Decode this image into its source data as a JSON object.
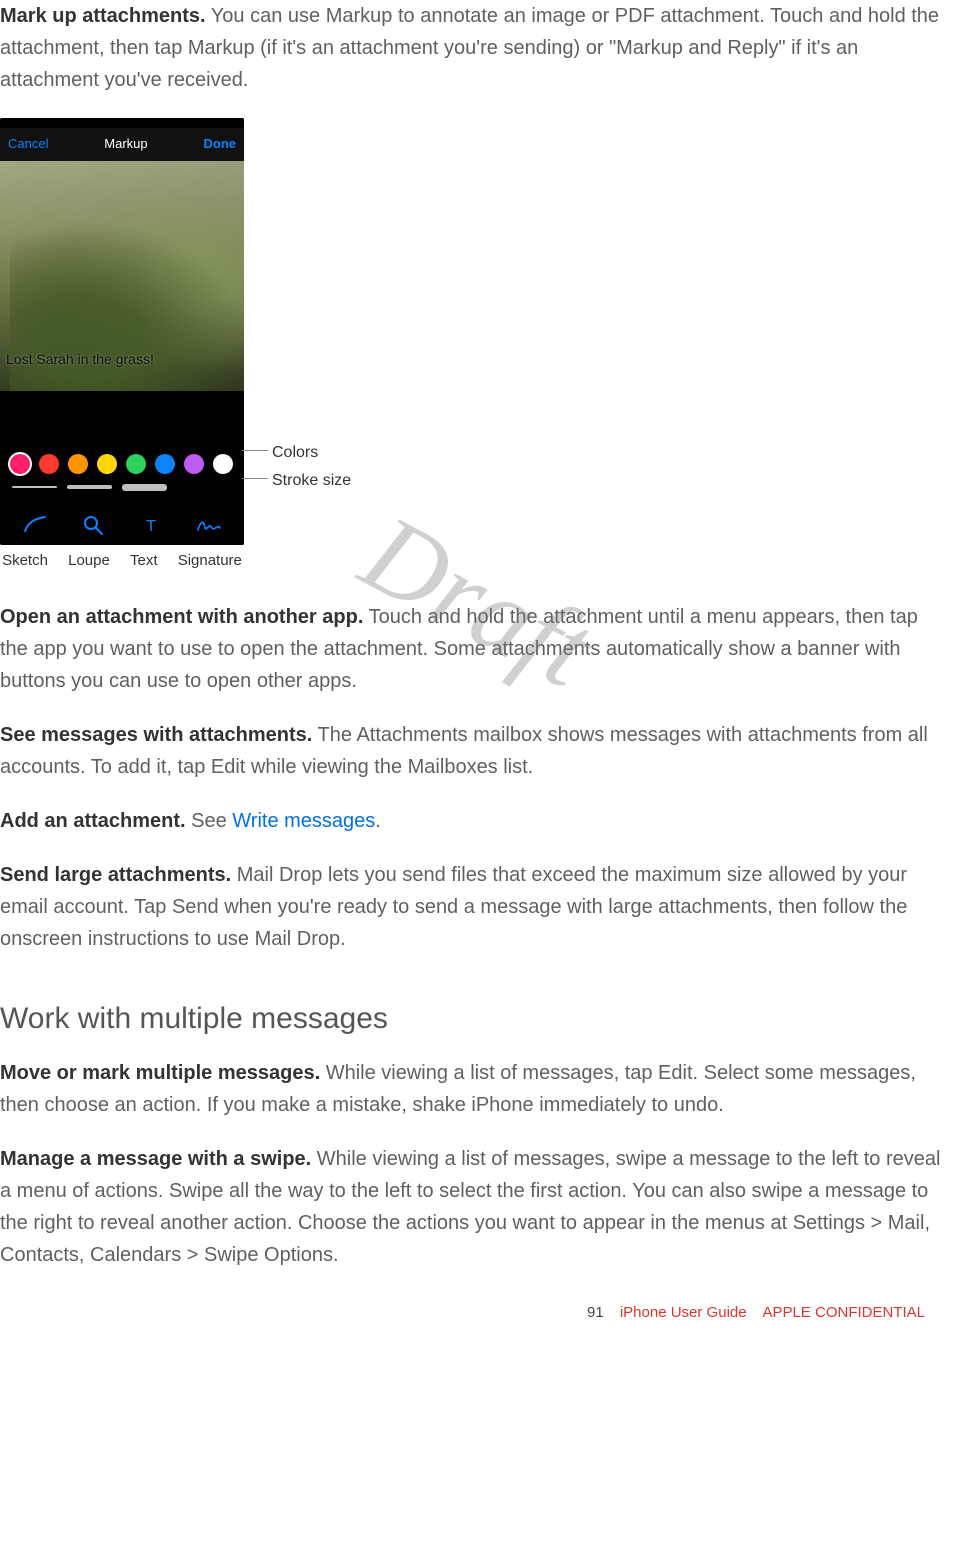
{
  "paragraphs": {
    "markup_title": "Mark up attachments.",
    "markup_body": " You can use Markup to annotate an image or PDF attachment. Touch and hold the attachment, then tap Markup (if it's an attachment you're sending) or \"Markup and Reply\" if it's an attachment you've received.",
    "open_title": "Open an attachment with another app.",
    "open_body": " Touch and hold the attachment until a menu appears, then tap the app you want to use to open the attachment. Some attachments automatically show a banner with buttons you can use to open other apps.",
    "see_title": "See messages with attachments.",
    "see_body": " The Attachments mailbox shows messages with attachments from all accounts. To add it, tap Edit while viewing the Mailboxes list.",
    "add_title": "Add an attachment.",
    "add_pre": " See ",
    "add_link": "Write messages",
    "add_post": ".",
    "send_title": "Send large attachments.",
    "send_body": " Mail Drop lets you send files that exceed the maximum size allowed by your email account. Tap Send when you're ready to send a message with large attachments, then follow the onscreen instructions to use Mail Drop.",
    "move_title": "Move or mark multiple messages. ",
    "move_body": " While viewing a list of messages, tap Edit. Select some messages, then choose an action. If you make a mistake, shake iPhone immediately to undo.",
    "manage_title": "Manage a message with a swipe.",
    "manage_body": " While viewing a list of messages, swipe a message to the left to reveal a menu of actions. Swipe all the way to the left to select the first action. You can also swipe a message to the right to reveal another action. Choose the actions you want to appear in the menus at Settings > Mail, Contacts, Calendars > Swipe Options."
  },
  "heading_work": "Work with multiple messages",
  "watermark": "Draft",
  "figure": {
    "nav": {
      "cancel": "Cancel",
      "title": "Markup",
      "done": "Done"
    },
    "photo_caption": "Lost Sarah in the grass!",
    "callouts": {
      "colors": "Colors",
      "stroke": "Stroke size"
    },
    "tool_labels": [
      "Sketch",
      "Loupe",
      "Text",
      "Signature"
    ],
    "colors": [
      "#ff1f6b",
      "#ff3b30",
      "#ff9500",
      "#ffd60a",
      "#30d158",
      "#0a84ff",
      "#bf5af2",
      "#ffffff"
    ]
  },
  "footer": {
    "page": "91",
    "title": "iPhone User Guide",
    "confidential": "APPLE CONFIDENTIAL"
  }
}
